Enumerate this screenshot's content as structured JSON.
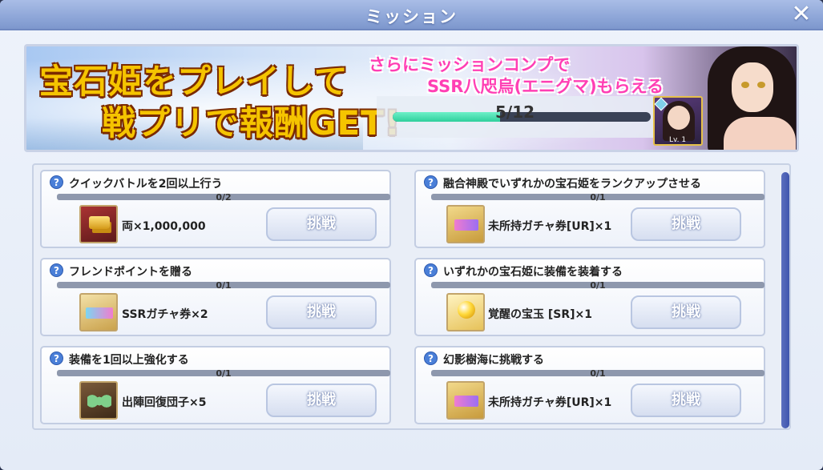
{
  "window": {
    "title": "ミッション",
    "close_symbol": "✕"
  },
  "banner": {
    "headline_line1": "宝石姫をプレイして",
    "headline_line2": "戦プリで報酬GET!",
    "promo_line1": "さらにミッションコンプで",
    "promo_line2": "SSR八咫烏(エニグマ)もらえる",
    "progress_text": "5/12",
    "progress_fraction": 0.4167,
    "portrait_level": "Lv. 1"
  },
  "missions": [
    {
      "title": "クイックバトルを2回以上行う",
      "count": "0/2",
      "reward": "両×1,000,000",
      "reward_icon": "gold-bars-icon",
      "button": "挑戦"
    },
    {
      "title": "融合神殿でいずれかの宝石姫をランクアップさせる",
      "count": "0/1",
      "reward": "未所持ガチャ券[UR]×1",
      "reward_icon": "ur-ticket-icon",
      "button": "挑戦"
    },
    {
      "title": "フレンドポイントを贈る",
      "count": "0/1",
      "reward": "SSRガチャ券×2",
      "reward_icon": "ssr-ticket-icon",
      "button": "挑戦"
    },
    {
      "title": "いずれかの宝石姫に装備を装着する",
      "count": "0/1",
      "reward": "覚醒の宝玉 [SR]×1",
      "reward_icon": "awakening-orb-icon",
      "button": "挑戦"
    },
    {
      "title": "装備を1回以上強化する",
      "count": "0/1",
      "reward": "出陣回復団子×5",
      "reward_icon": "dango-icon",
      "button": "挑戦"
    },
    {
      "title": "幻影樹海に挑戦する",
      "count": "0/1",
      "reward": "未所持ガチャ券[UR]×1",
      "reward_icon": "ur-ticket-icon",
      "button": "挑戦"
    }
  ],
  "help_symbol": "?",
  "colors": {
    "title_bar": "#8ea6d8",
    "progress_fill": "#2fcf9c",
    "accent_pink": "#ff3fb4",
    "headline_gold": "#f5c400"
  }
}
